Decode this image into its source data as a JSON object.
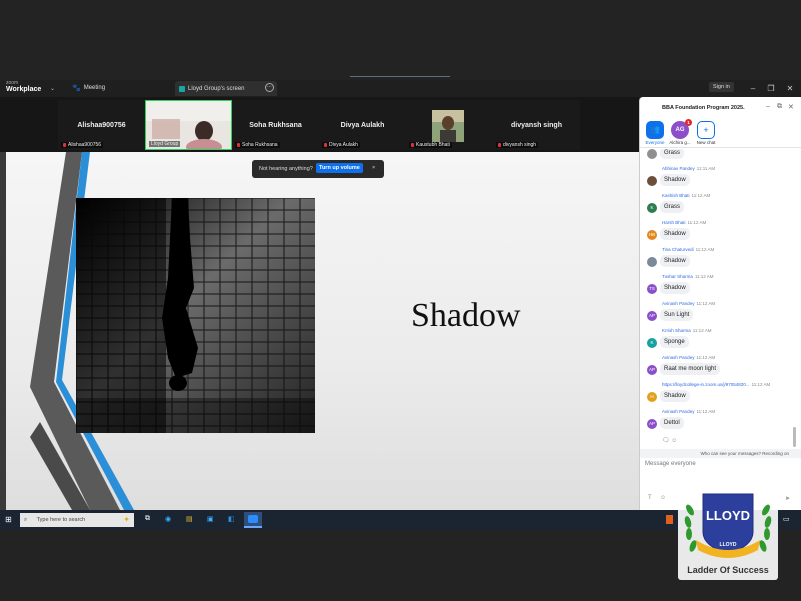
{
  "zoom": {
    "brand_top": "zoom",
    "brand_bottom": "Workplace",
    "meeting_label": "Meeting",
    "screen_tab_label": "Lloyd Group's screen",
    "sign_in": "Sign in"
  },
  "gallery": {
    "tiles": [
      {
        "big": "Alishaa900756",
        "small": "Alishaa900756"
      },
      {
        "big": "",
        "small": "Lloyd Group"
      },
      {
        "big": "Soha Rukhsana",
        "small": "Soha Rukhsana"
      },
      {
        "big": "Divya Aulakh",
        "small": "Divya Aulakh"
      },
      {
        "big": "",
        "small": "Kaustubh Bhati"
      },
      {
        "big": "divyansh singh",
        "small": "divyansh singh"
      }
    ]
  },
  "toast": {
    "text": "Not hearing anything?",
    "button": "Turn up volume",
    "close": "×"
  },
  "slide": {
    "title": "Shadow"
  },
  "chat": {
    "title": "BBA Foundation Program 2025.",
    "tabs": [
      {
        "label": "Everyone",
        "avatar": ""
      },
      {
        "label": "Alchira g...",
        "avatar": "AG",
        "badge": "1"
      },
      {
        "label": "New chat",
        "avatar": "+"
      }
    ],
    "top_message": "Grass",
    "messages": [
      {
        "initials": "",
        "color": "#6b4f3a",
        "name": "Abhinav Pandey",
        "time": "11:11 AM",
        "text": "Shadow"
      },
      {
        "initials": "K",
        "color": "#2e7d4f",
        "name": "Kashish Bhati",
        "time": "11:12 AM",
        "text": "Grass"
      },
      {
        "initials": "HB",
        "color": "#e08a1e",
        "name": "Harsh Bhati",
        "time": "11:12 AM",
        "text": "Shadow"
      },
      {
        "initials": "",
        "color": "#7a8a99",
        "name": "Tina Chaturvedi",
        "time": "11:12 AM",
        "text": "Shadow"
      },
      {
        "initials": "TS",
        "color": "#8a4fc9",
        "name": "Tushar Sharma",
        "time": "11:12 AM",
        "text": "Shadow"
      },
      {
        "initials": "AP",
        "color": "#8a4fc9",
        "name": "Avinash Pandey",
        "time": "11:12 AM",
        "text": "Sun Light"
      },
      {
        "initials": "K",
        "color": "#17a2a2",
        "name": "Krrish Sharma",
        "time": "11:12 AM",
        "text": "Sponge"
      },
      {
        "initials": "AP",
        "color": "#8a4fc9",
        "name": "Avinash Pandey",
        "time": "11:12 AM",
        "text": "Raat me moon light"
      },
      {
        "initials": "H",
        "color": "#e0a21e",
        "name": "https://lloydcollege-in.zoom.us/j/97054820...",
        "time": "11:12 AM",
        "text": "Shadow"
      },
      {
        "initials": "AP",
        "color": "#8a4fc9",
        "name": "Avinash Pandey",
        "time": "11:12 AM",
        "text": "Dettol"
      }
    ],
    "info_bar": "Who can see your messages? Recording on",
    "input_placeholder": "Message everyone"
  },
  "taskbar": {
    "search_placeholder": "Type here to search"
  },
  "logo": {
    "name": "LLOYD",
    "sub": "LLOYD",
    "tagline": "Ladder Of Success"
  }
}
